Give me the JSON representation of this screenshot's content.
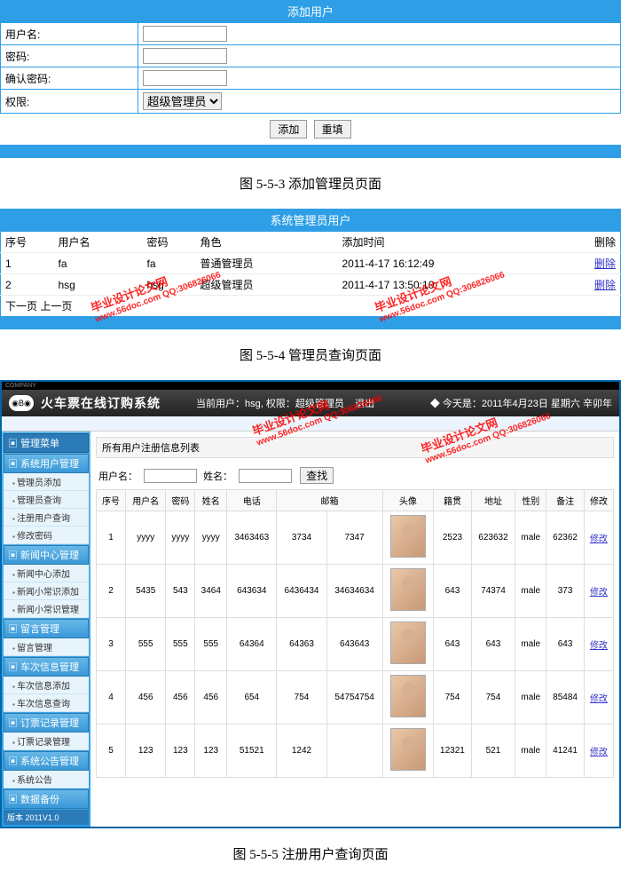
{
  "addUser": {
    "title": "添加用户",
    "fields": {
      "username_label": "用户名:",
      "password_label": "密码:",
      "confirm_label": "确认密码:",
      "perm_label": "权限:",
      "perm_value": "超级管理员"
    },
    "btn_add": "添加",
    "btn_reset": "重填"
  },
  "caption1": "图 5-5-3 添加管理员页面",
  "adminList": {
    "title": "系统管理员用户",
    "headers": {
      "seq": "序号",
      "username": "用户名",
      "password": "密码",
      "role": "角色",
      "addtime": "添加时间",
      "delete": "删除"
    },
    "rows": [
      {
        "seq": "1",
        "username": "fa",
        "password": "fa",
        "role": "普通管理员",
        "addtime": "2011-4-17 16:12:49",
        "del": "删除"
      },
      {
        "seq": "2",
        "username": "hsg",
        "password": "hsg",
        "role": "超级管理员",
        "addtime": "2011-4-17 13:50:10",
        "del": "删除"
      }
    ],
    "pager_prev": "下一页",
    "pager_next": "上一页"
  },
  "caption2": "图 5-5-4 管理员查询页面",
  "app": {
    "company": "COMPANY",
    "title": "火车票在线订购系统",
    "topbar_user": "当前用户：hsg, 权限：超级管理员",
    "topbar_logout": "退出",
    "topbar_date": "◆ 今天是：2011年4月23日  星期六  辛卯年",
    "sidebar": {
      "header": "管理菜单",
      "groups": [
        {
          "name": "系统用户管理",
          "items": [
            "管理员添加",
            "管理员查询",
            "注册用户查询",
            "修改密码"
          ]
        },
        {
          "name": "新闻中心管理",
          "items": [
            "新闻中心添加",
            "新闻小常识添加",
            "新闻小常识管理"
          ]
        },
        {
          "name": "留言管理",
          "items": [
            "留言管理"
          ]
        },
        {
          "name": "车次信息管理",
          "items": [
            "车次信息添加",
            "车次信息查询"
          ]
        },
        {
          "name": "订票记录管理",
          "items": [
            "订票记录管理"
          ]
        },
        {
          "name": "系统公告管理",
          "items": [
            "系统公告"
          ]
        },
        {
          "name": "数据备份",
          "items": []
        }
      ],
      "footer": "版本 2011V1.0"
    },
    "content": {
      "title": "所有用户注册信息列表",
      "filter_user_label": "用户名：",
      "filter_name_label": "姓名：",
      "btn_search": "查找",
      "headers": {
        "seq": "序号",
        "username": "用户名",
        "password": "密码",
        "realname": "姓名",
        "phone": "电话",
        "email": "邮箱",
        "avatar": "头像",
        "native": "籍贯",
        "address": "地址",
        "gender": "性别",
        "remark": "备注",
        "modify": "修改"
      },
      "rows": [
        {
          "seq": "1",
          "username": "yyyy",
          "password": "yyyy",
          "realname": "yyyy",
          "phone": "3463463",
          "email": "3734",
          "email2": "7347",
          "native": "2523",
          "address": "623632",
          "gender": "male",
          "remark": "62362",
          "modify": "修改"
        },
        {
          "seq": "2",
          "username": "5435",
          "password": "543",
          "realname": "3464",
          "phone": "643634",
          "email": "6436434",
          "email2": "34634634",
          "native": "643",
          "address": "74374",
          "gender": "male",
          "remark": "373",
          "modify": "修改"
        },
        {
          "seq": "3",
          "username": "555",
          "password": "555",
          "realname": "555",
          "phone": "64364",
          "email": "64363",
          "email2": "643643",
          "native": "643",
          "address": "643",
          "gender": "male",
          "remark": "643",
          "modify": "修改"
        },
        {
          "seq": "4",
          "username": "456",
          "password": "456",
          "realname": "456",
          "phone": "654",
          "email": "754",
          "email2": "54754754",
          "native": "754",
          "address": "754",
          "gender": "male",
          "remark": "85484",
          "modify": "修改"
        },
        {
          "seq": "5",
          "username": "123",
          "password": "123",
          "realname": "123",
          "phone": "51521",
          "email": "1242",
          "email2": "",
          "native": "12321",
          "address": "521",
          "gender": "male",
          "remark": "41241",
          "modify": "修改"
        }
      ]
    }
  },
  "caption3": "图 5-5-5 注册用户查询页面",
  "watermark": {
    "text1": "毕业设计论文网",
    "text2": "www.56doc.com  QQ:306826066"
  }
}
